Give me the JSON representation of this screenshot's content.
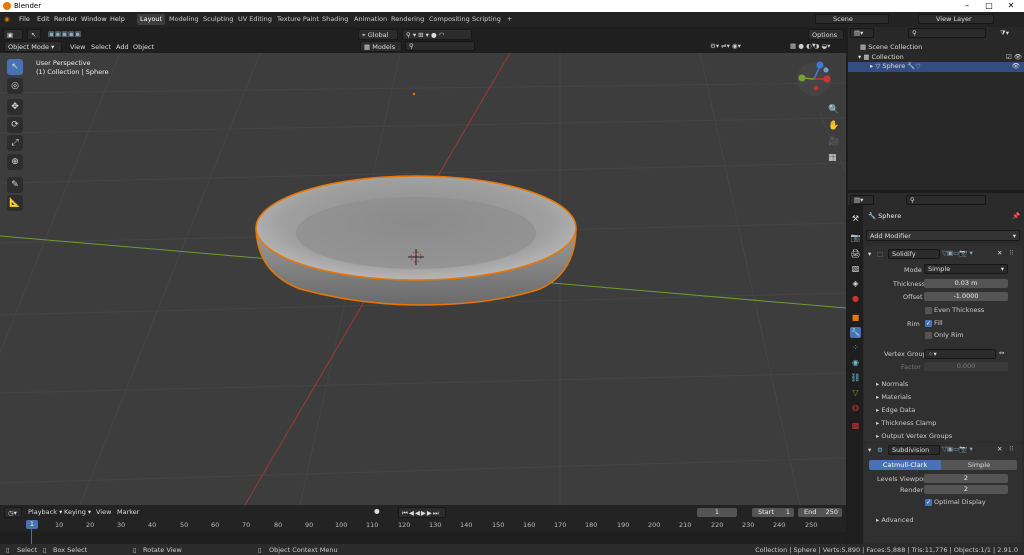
{
  "window": {
    "title": "Blender"
  },
  "menu": [
    "File",
    "Edit",
    "Render",
    "Window",
    "Help"
  ],
  "workspaces": [
    "Layout",
    "Modeling",
    "Sculpting",
    "UV Editing",
    "Texture Paint",
    "Shading",
    "Animation",
    "Rendering",
    "Compositing",
    "Scripting"
  ],
  "active_workspace": "Layout",
  "scene": {
    "label": "Scene",
    "view_layer": "View Layer"
  },
  "viewport_header": {
    "mode": "Object Mode",
    "menus": [
      "View",
      "Select",
      "Add",
      "Object"
    ],
    "orientation": "Global",
    "collection": "Models",
    "options": "Options"
  },
  "viewport": {
    "view_name": "User Perspective",
    "collection_label": "(1) Collection | Sphere"
  },
  "outliner": {
    "items": [
      {
        "label": "Scene Collection"
      },
      {
        "label": "Collection"
      },
      {
        "label": "Sphere"
      }
    ]
  },
  "properties": {
    "object_name": "Sphere",
    "add_modifier": "Add Modifier",
    "solidify": {
      "name": "Solidify",
      "mode_label": "Mode",
      "mode_value": "Simple",
      "thickness_label": "Thickness",
      "thickness_value": "0.03 m",
      "offset_label": "Offset",
      "offset_value": "-1.0000",
      "even_thickness": "Even Thickness",
      "rim_label": "Rim",
      "fill": "Fill",
      "only_rim": "Only Rim",
      "vertex_group_label": "Vertex Group",
      "factor_label": "Factor",
      "factor_value": "0.000",
      "panels": [
        "Normals",
        "Materials",
        "Edge Data",
        "Thickness Clamp",
        "Output Vertex Groups"
      ]
    },
    "subdivision": {
      "name": "Subdivision",
      "catmull": "Catmull-Clark",
      "simple": "Simple",
      "levels_label": "Levels Viewport",
      "levels_value": "2",
      "render_label": "Render",
      "render_value": "2",
      "optimal": "Optimal Display",
      "advanced": "Advanced"
    }
  },
  "timeline": {
    "menus": [
      "Playback",
      "Keying",
      "View",
      "Marker"
    ],
    "current_frame": "1",
    "start_label": "Start",
    "start_value": "1",
    "end_label": "End",
    "end_value": "250",
    "ticks": [
      "1",
      "10",
      "20",
      "30",
      "40",
      "50",
      "60",
      "70",
      "80",
      "90",
      "100",
      "110",
      "120",
      "130",
      "140",
      "150",
      "160",
      "170",
      "180",
      "190",
      "200",
      "210",
      "220",
      "230",
      "240",
      "250"
    ]
  },
  "statusbar": {
    "select": "Select",
    "box_select": "Box Select",
    "rotate": "Rotate View",
    "context": "Object Context Menu",
    "stats": "Collection | Sphere | Verts:5,890 | Faces:5,888 | Tris:11,776 | Objects:1/1 | 2.91.0"
  },
  "colors": {
    "accent": "#4772b3",
    "selection": "#ea7600",
    "background": "#3d3d3d"
  }
}
